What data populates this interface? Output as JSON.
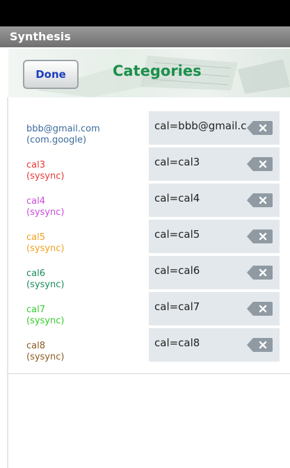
{
  "app": {
    "title": "Synthesis"
  },
  "header": {
    "done_label": "Done",
    "title": "Categories"
  },
  "rows": [
    {
      "account": "bbb@gmail.com",
      "type": "(com.google)",
      "mapping": "cal=bbb@gmail.com",
      "color": "#3b6a9a"
    },
    {
      "account": "cal3",
      "type": "(sysync)",
      "mapping": "cal=cal3",
      "color": "#e53935"
    },
    {
      "account": "cal4",
      "type": "(sysync)",
      "mapping": "cal=cal4",
      "color": "#c84bd8"
    },
    {
      "account": "cal5",
      "type": "(sysync)",
      "mapping": "cal=cal5",
      "color": "#f0a020"
    },
    {
      "account": "cal6",
      "type": "(sysync)",
      "mapping": "cal=cal6",
      "color": "#178a5a"
    },
    {
      "account": "cal7",
      "type": "(sysync)",
      "mapping": "cal=cal7",
      "color": "#33cc2a"
    },
    {
      "account": "cal8",
      "type": "(sysync)",
      "mapping": "cal=cal8",
      "color": "#8a5a20"
    }
  ]
}
